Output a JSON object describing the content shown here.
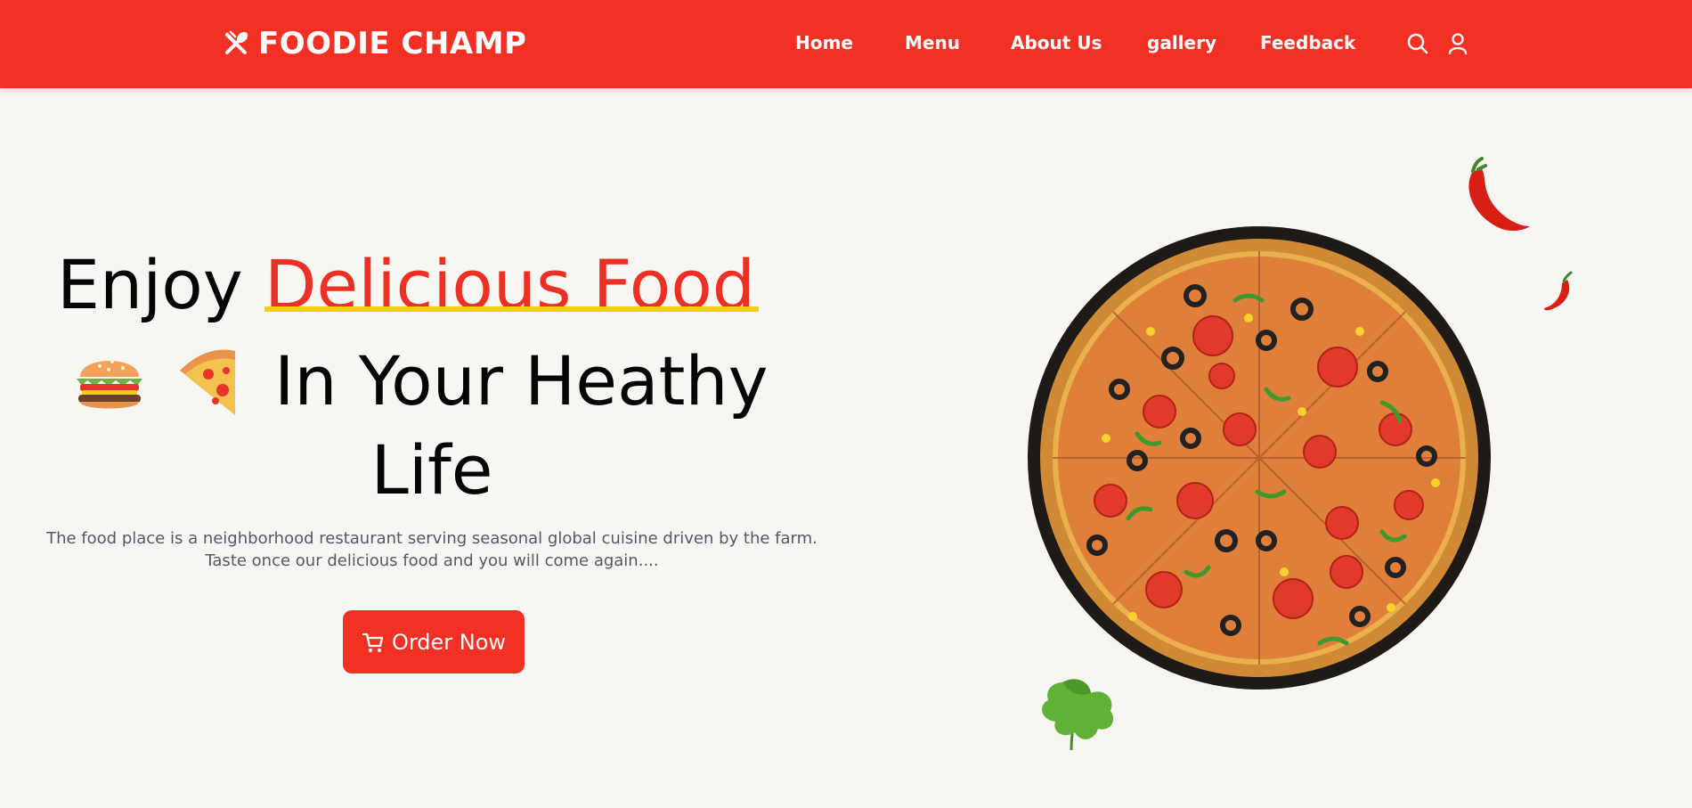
{
  "brand": {
    "name": "FOODIE CHAMP",
    "icon": "utensils-icon"
  },
  "nav": {
    "links": [
      "Home",
      "Menu",
      "About Us",
      "gallery",
      "Feedback"
    ],
    "search_icon": "search-icon",
    "user_icon": "user-icon"
  },
  "hero": {
    "headline_part1": "Enjoy",
    "headline_highlight": "Delicious Food",
    "headline_part2": "In Your Heathy",
    "headline_part3": "Life",
    "emojis": [
      "burger-icon",
      "pizza-slice-icon"
    ],
    "description": "The food place is a neighborhood restaurant serving seasonal global cuisine driven by the farm. Taste once our delicious food and you will come again....",
    "order_button": "Order Now",
    "order_icon": "cart-icon"
  },
  "images": [
    "pizza-image",
    "chili-image",
    "parsley-image"
  ],
  "colors": {
    "primary": "#f23024",
    "underline": "#f5cc16",
    "background": "#f8f6f2",
    "text": "#050505"
  }
}
